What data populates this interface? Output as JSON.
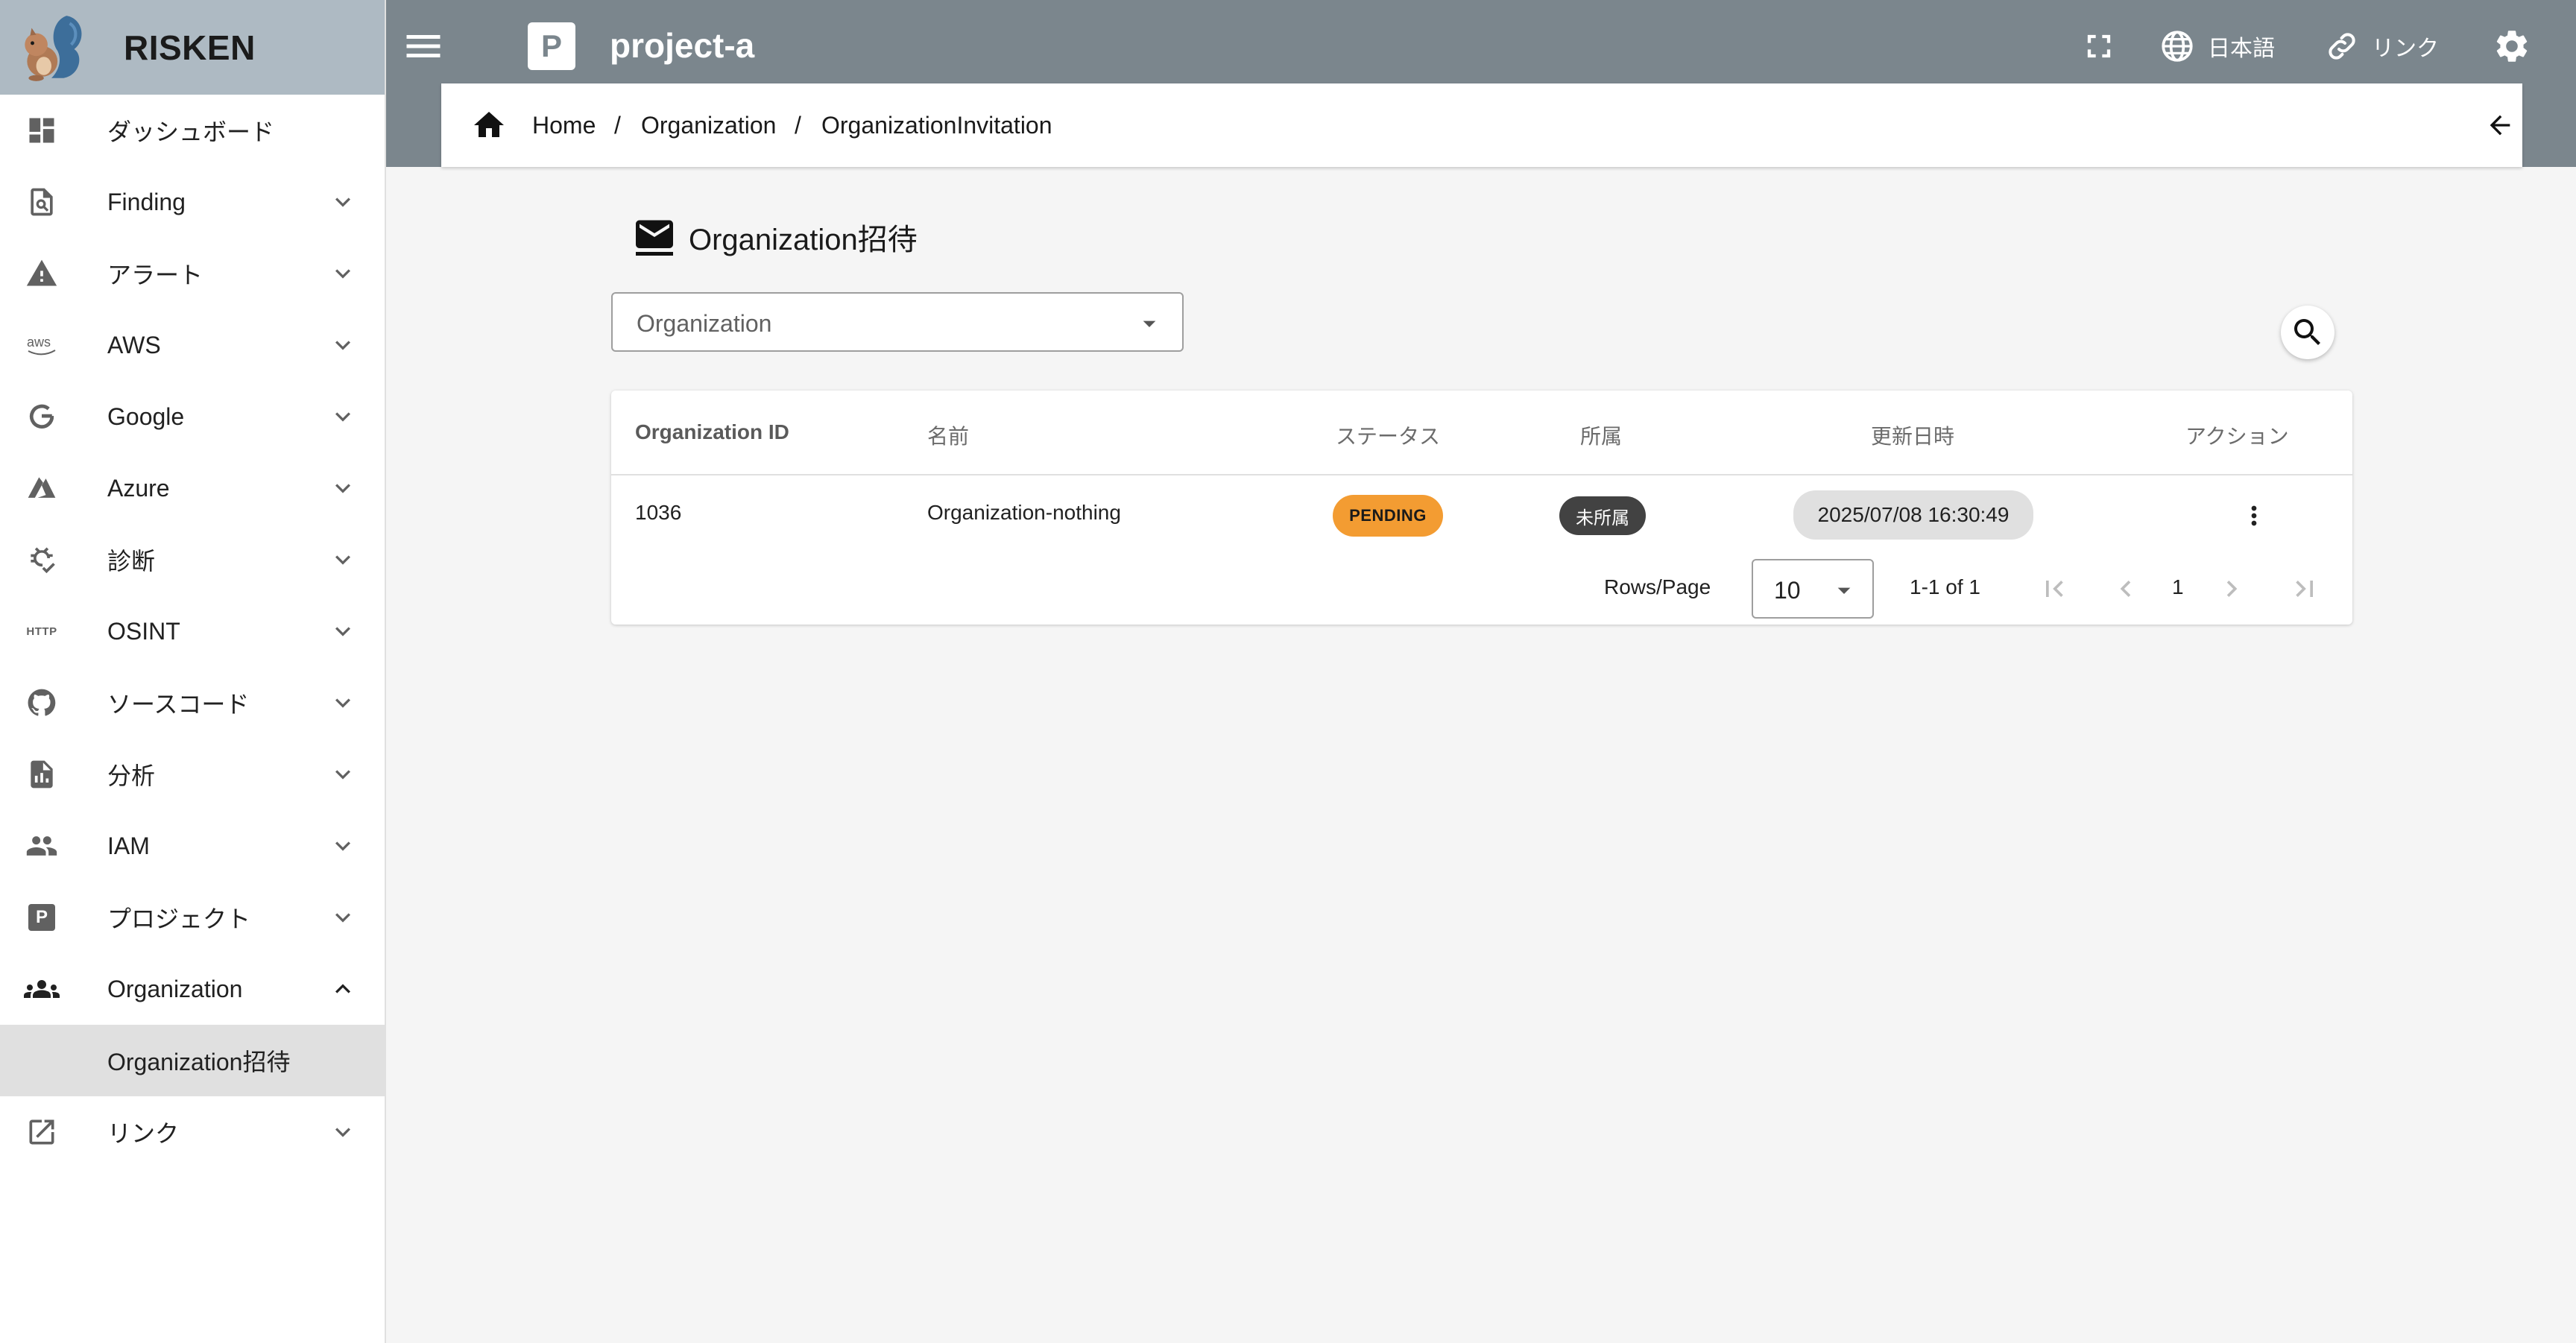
{
  "brand": {
    "name": "RISKEN"
  },
  "sidebar": {
    "items": [
      {
        "label": "ダッシュボード",
        "icon": "dashboard-icon"
      },
      {
        "label": "Finding",
        "icon": "finding-icon"
      },
      {
        "label": "アラート",
        "icon": "alert-icon"
      },
      {
        "label": "AWS",
        "icon": "aws-icon"
      },
      {
        "label": "Google",
        "icon": "google-icon"
      },
      {
        "label": "Azure",
        "icon": "azure-icon"
      },
      {
        "label": "診断",
        "icon": "diagnosis-icon"
      },
      {
        "label": "OSINT",
        "icon": "http-icon",
        "icon_text": "HTTP"
      },
      {
        "label": "ソースコード",
        "icon": "github-icon"
      },
      {
        "label": "分析",
        "icon": "analysis-icon"
      },
      {
        "label": "IAM",
        "icon": "iam-icon"
      },
      {
        "label": "プロジェクト",
        "icon": "project-icon",
        "icon_text": "P"
      },
      {
        "label": "Organization",
        "icon": "organization-icon"
      },
      {
        "label": "Organization招待",
        "icon": ""
      },
      {
        "label": "リンク",
        "icon": "external-link-icon"
      }
    ]
  },
  "header": {
    "project_badge": "P",
    "project_name": "project-a",
    "language_label": "日本語",
    "link_label": "リンク"
  },
  "breadcrumb": {
    "items": [
      "Home",
      "Organization",
      "OrganizationInvitation"
    ],
    "separator": "/"
  },
  "page": {
    "title": "Organization招待",
    "organization_select": {
      "value": "Organization"
    }
  },
  "table": {
    "columns": [
      "Organization ID",
      "名前",
      "ステータス",
      "所属",
      "更新日時",
      "アクション"
    ],
    "rows": [
      {
        "organization_id": "1036",
        "name": "Organization-nothing",
        "status": "PENDING",
        "affiliation": "未所属",
        "updated_at": "2025/07/08 16:30:49"
      }
    ]
  },
  "pagination": {
    "rows_per_page_label": "Rows/Page",
    "rows_per_page": "10",
    "range": "1-1 of 1",
    "current_page": "1"
  },
  "colors": {
    "header": "#7b868d",
    "brand_bar": "#aebac3",
    "status_pending": "#f39c32",
    "affiliation_chip": "#424242"
  }
}
